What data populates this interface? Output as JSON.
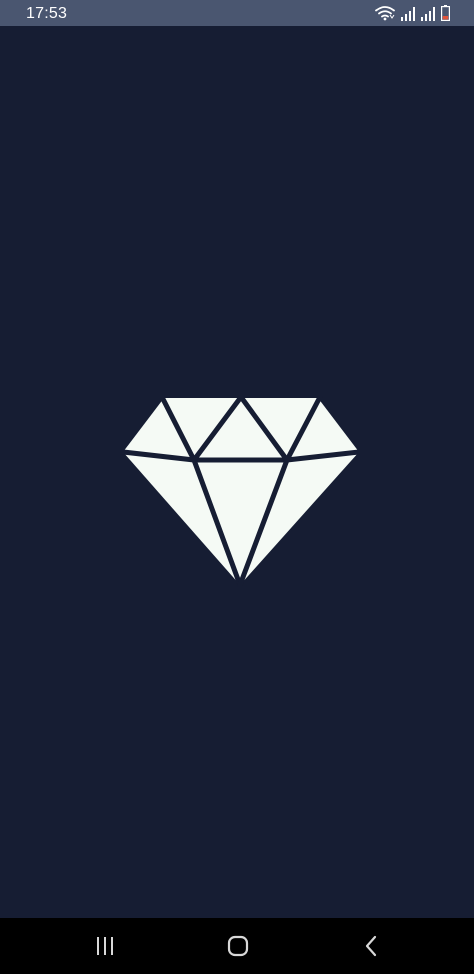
{
  "status_bar": {
    "time": "17:53",
    "icons": [
      "wifi-icon",
      "signal-icon",
      "signal-icon",
      "battery-low-icon"
    ],
    "background": "#4a5670"
  },
  "splash": {
    "background": "#161d33",
    "logo": "diamond-icon",
    "logo_color": "#f5faf5"
  },
  "nav_bar": {
    "buttons": [
      "recent-apps-icon",
      "home-icon",
      "back-icon"
    ],
    "background": "#000000"
  }
}
